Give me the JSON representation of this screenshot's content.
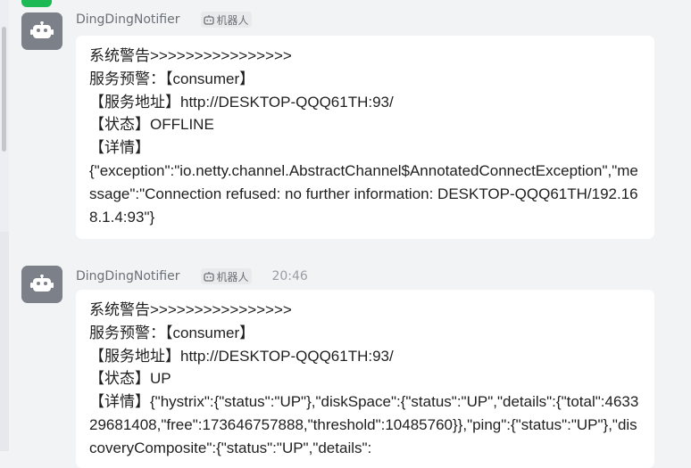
{
  "top_bar": {
    "icons": [
      "minimize-icon",
      "maximize-icon",
      "close-icon"
    ]
  },
  "messages": [
    {
      "sender": "DingDingNotifier",
      "badge": "机器人",
      "time": "",
      "lines": [
        "系统警告>>>>>>>>>>>>>>>>",
        "服务预警：【consumer】",
        "【服务地址】http://DESKTOP-QQQ61TH:93/",
        "【状态】OFFLINE",
        "【详情】",
        "{\"exception\":\"io.netty.channel.AbstractChannel$AnnotatedConnectException\",\"message\":\"Connection refused: no further information: DESKTOP-QQQ61TH/192.168.1.4:93\"}"
      ]
    },
    {
      "sender": "DingDingNotifier",
      "badge": "机器人",
      "time": "20:46",
      "lines": [
        "系统警告>>>>>>>>>>>>>>>>",
        "服务预警：【consumer】",
        "【服务地址】http://DESKTOP-QQQ61TH:93/",
        "【状态】UP",
        "【详情】{\"hystrix\":{\"status\":\"UP\"},\"diskSpace\":{\"status\":\"UP\",\"details\":{\"total\":463329681408,\"free\":173646757888,\"threshold\":10485760}},\"ping\":{\"status\":\"UP\"},\"discoveryComposite\":{\"status\":\"UP\",\"details\":"
      ]
    }
  ]
}
